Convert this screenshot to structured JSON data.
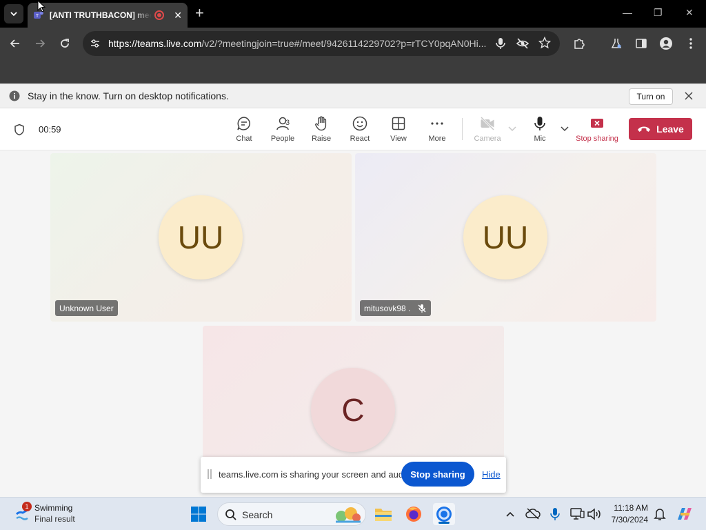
{
  "browser": {
    "tab_title": "[ANTI TRUTHBACON] meeting",
    "tab_close": "✕",
    "new_tab": "+",
    "url_host": "https://teams.live.com",
    "url_path": "/v2/?meetingjoin=true#/meet/9426114229702?p=rTCY0pqAN0Hi...",
    "win_min": "—",
    "win_max": "❐",
    "win_close": "✕"
  },
  "notification": {
    "text": "Stay in the know. Turn on desktop notifications.",
    "button": "Turn on"
  },
  "meeting": {
    "timer": "00:59",
    "controls": {
      "chat": "Chat",
      "people": "People",
      "people_count": "3",
      "raise": "Raise",
      "react": "React",
      "view": "View",
      "more": "More",
      "camera": "Camera",
      "mic": "Mic",
      "stop_sharing": "Stop sharing",
      "leave": "Leave"
    },
    "colors": {
      "leave": "#c4314b",
      "accent_blue": "#0b57d0"
    }
  },
  "participants": [
    {
      "initials": "UU",
      "name": "Unknown User",
      "muted": false
    },
    {
      "initials": "UU",
      "name": "mitusovk98 .",
      "muted": true
    },
    {
      "initials": "C",
      "name": "",
      "muted": false
    }
  ],
  "sharing_bar": {
    "text": "teams.live.com is sharing your screen and audio.",
    "stop_button": "Stop sharing",
    "hide_link": "Hide"
  },
  "taskbar": {
    "weather_badge": "1",
    "weather_title": "Swimming",
    "weather_subtitle": "Final result",
    "search_placeholder": "Search",
    "time": "11:18 AM",
    "date": "7/30/2024"
  }
}
